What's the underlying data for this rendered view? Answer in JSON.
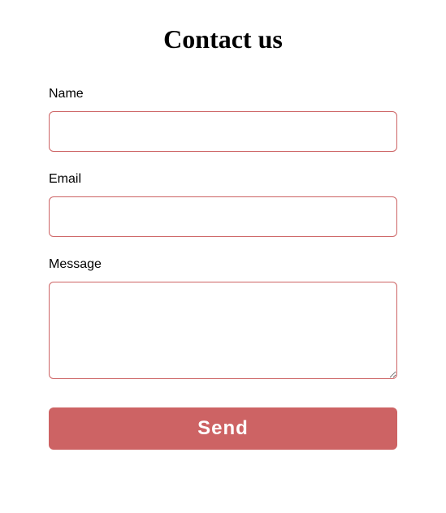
{
  "title": "Contact us",
  "form": {
    "name": {
      "label": "Name",
      "value": ""
    },
    "email": {
      "label": "Email",
      "value": ""
    },
    "message": {
      "label": "Message",
      "value": ""
    },
    "submit_label": "Send"
  },
  "colors": {
    "accent": "#cd6364"
  }
}
